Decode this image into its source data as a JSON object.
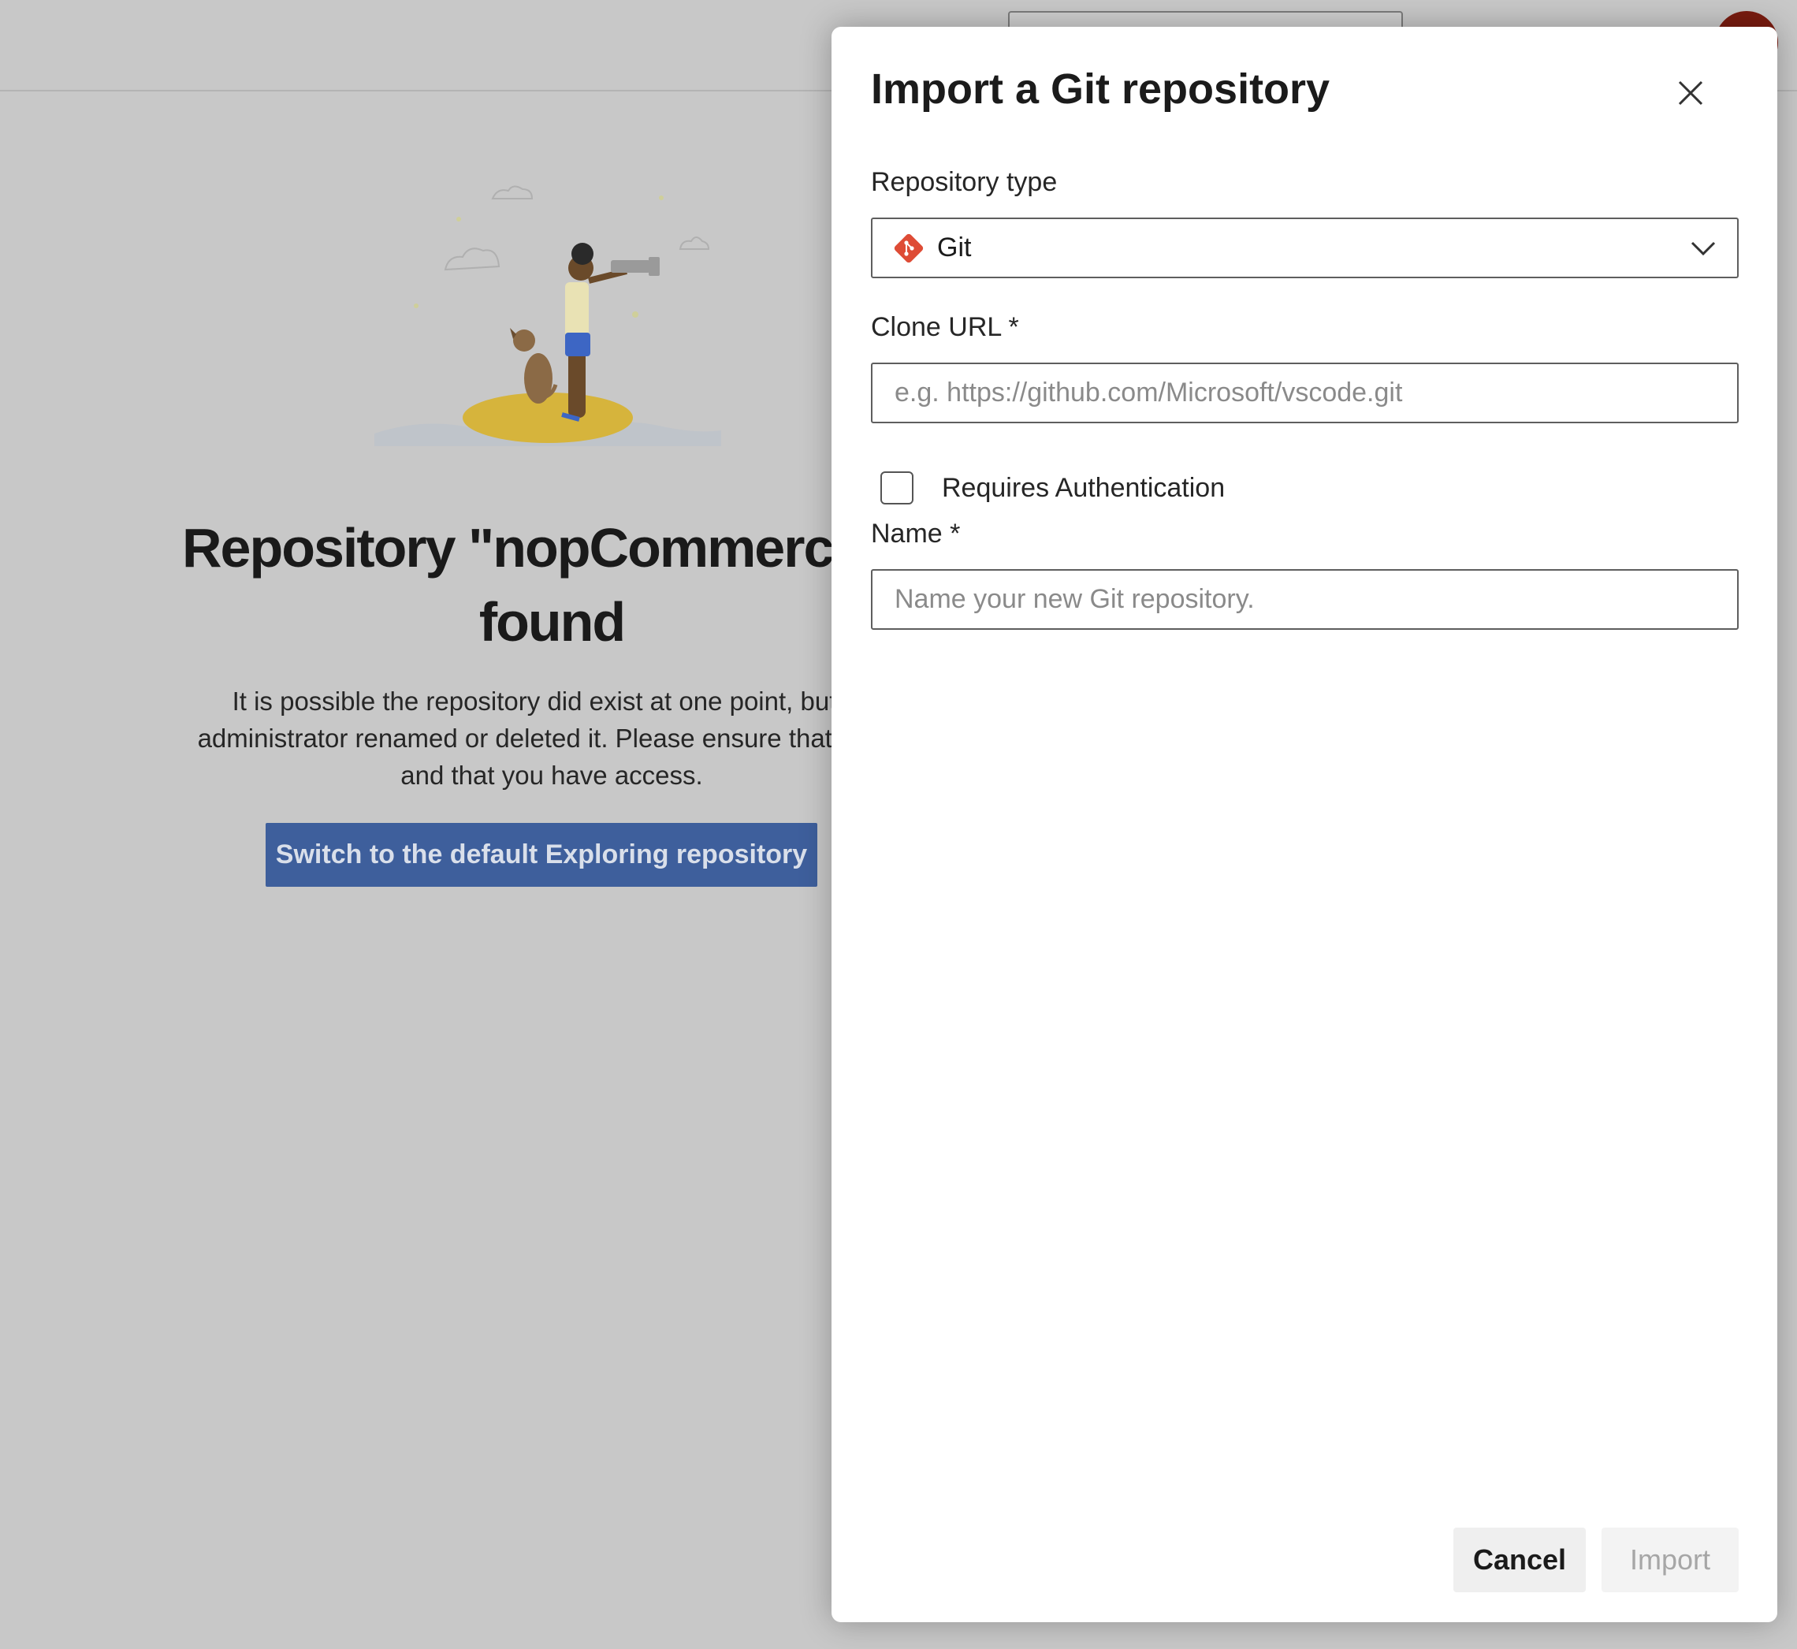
{
  "background_page": {
    "title_line1": "Repository \"nopCommerce.gi",
    "title_line2": "found",
    "description_line1": "It is possible the repository did exist at one point, but yo",
    "description_line2": "administrator renamed or deleted it. Please ensure that the re",
    "description_line3": "and that you have access.",
    "switch_button_label": "Switch to the default Exploring repository"
  },
  "dialog": {
    "title": "Import a Git repository",
    "repository_type": {
      "label": "Repository type",
      "selected_value": "Git",
      "icon": "git-icon"
    },
    "clone_url": {
      "label": "Clone URL *",
      "value": "",
      "placeholder": "e.g. https://github.com/Microsoft/vscode.git"
    },
    "requires_authentication": {
      "label": "Requires Authentication",
      "checked": false
    },
    "name": {
      "label": "Name *",
      "value": "",
      "placeholder": "Name your new Git repository."
    },
    "buttons": {
      "cancel": "Cancel",
      "import": "Import"
    }
  },
  "colors": {
    "overlay": "#c8c8c8",
    "primary_button": "#3e5f9c",
    "git_brand": "#de4c36",
    "avatar": "#7a1c10"
  }
}
